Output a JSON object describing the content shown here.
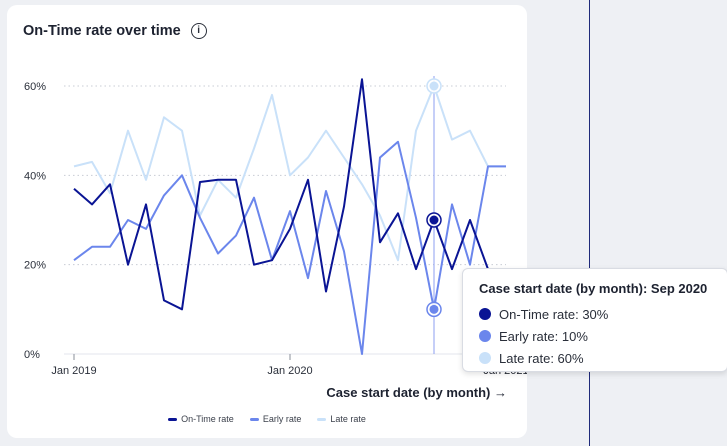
{
  "card": {
    "title": "On-Time rate over time"
  },
  "colors": {
    "ontime": "#0a1494",
    "early": "#6b86ec",
    "late": "#c9e1f9",
    "grid": "#c8ccd4",
    "axis": "#2a2f3a"
  },
  "tooltip": {
    "title": "Case start date (by month): Sep 2020",
    "rows": [
      "On-Time rate: 30%",
      "Early rate: 10%",
      "Late rate: 60%"
    ]
  },
  "chart_data": {
    "type": "line",
    "title": "On-Time rate over time",
    "xlabel": "Case start date (by month) →",
    "ylabel": "",
    "ylim": [
      0,
      60
    ],
    "y_ticks": [
      "0%",
      "20%",
      "40%",
      "60%"
    ],
    "x_tick_labels": [
      "Jan 2019",
      "Jan 2020",
      "Jan 2021"
    ],
    "x": [
      "Jan 2019",
      "Feb 2019",
      "Mar 2019",
      "Apr 2019",
      "May 2019",
      "Jun 2019",
      "Jul 2019",
      "Aug 2019",
      "Sep 2019",
      "Oct 2019",
      "Nov 2019",
      "Dec 2019",
      "Jan 2020",
      "Feb 2020",
      "Mar 2020",
      "Apr 2020",
      "May 2020",
      "Jun 2020",
      "Jul 2020",
      "Aug 2020",
      "Sep 2020",
      "Oct 2020",
      "Nov 2020",
      "Dec 2020",
      "Jan 2021"
    ],
    "series": [
      {
        "name": "On-Time rate",
        "values": [
          37,
          33.5,
          38,
          20,
          33.5,
          12,
          10,
          38.5,
          39,
          39,
          20,
          21,
          28,
          39,
          14,
          33,
          61.5,
          25,
          31.5,
          19,
          30,
          19,
          30,
          19,
          14
        ]
      },
      {
        "name": "Early rate",
        "values": [
          21,
          24,
          24,
          30,
          28,
          35.5,
          40,
          30.5,
          22.5,
          26.5,
          35,
          21,
          32,
          17,
          36.5,
          23,
          0,
          44,
          47.5,
          30.5,
          10,
          33.5,
          20,
          42,
          42
        ]
      },
      {
        "name": "Late rate",
        "values": [
          42,
          43,
          36,
          50,
          39,
          53,
          50,
          31,
          39,
          35,
          46,
          58,
          40,
          44,
          50,
          44,
          38,
          31,
          21,
          50,
          60,
          48,
          50,
          42,
          42
        ]
      }
    ],
    "highlight": {
      "x": "Sep 2020",
      "on_time": 30,
      "early": 10,
      "late": 60
    },
    "grid": true,
    "legend": "bottom-center"
  }
}
